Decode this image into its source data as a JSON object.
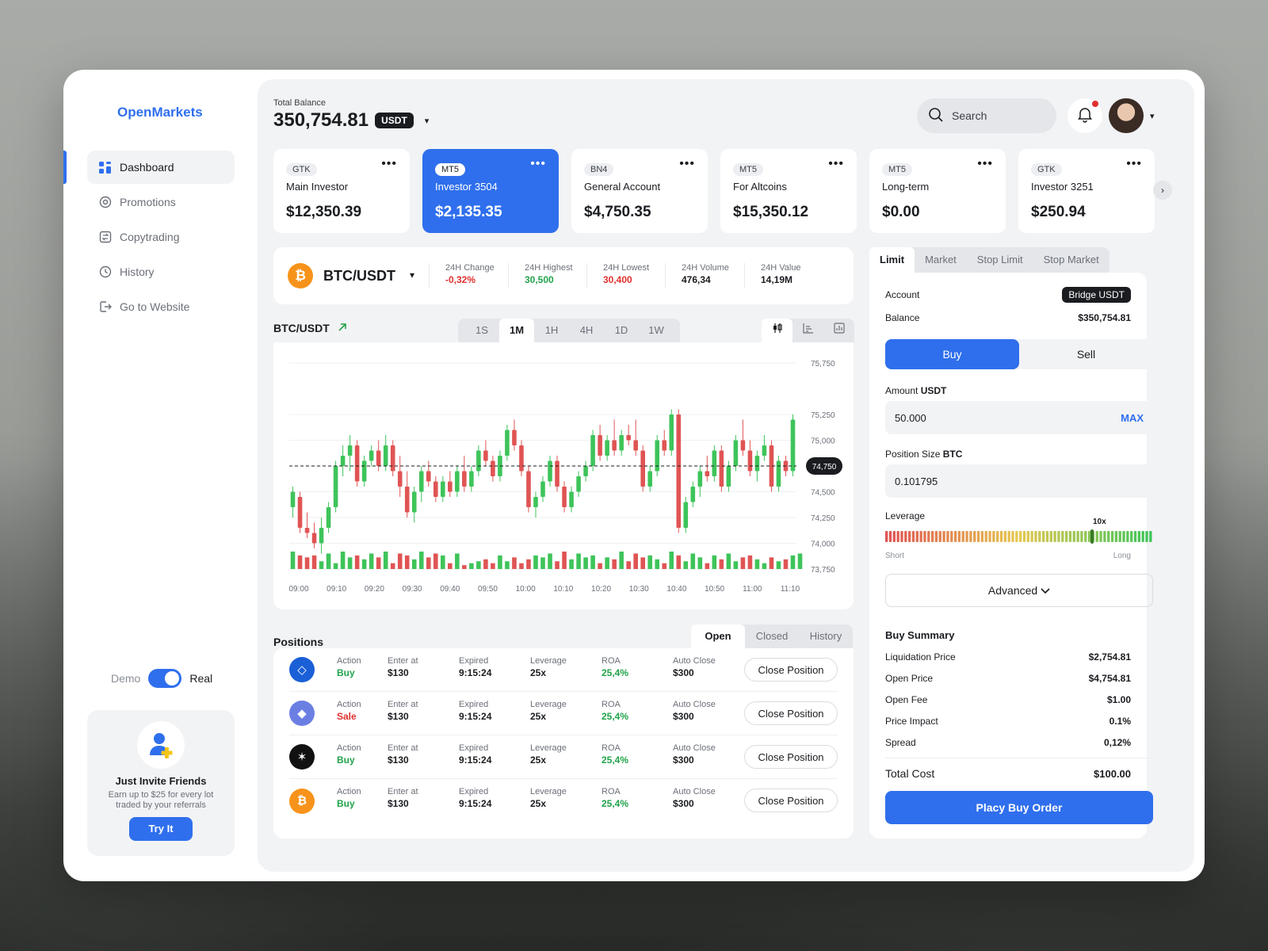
{
  "app": {
    "name": "OpenMarkets"
  },
  "sidebar": {
    "items": [
      {
        "label": "Dashboard",
        "icon": "dashboard-icon",
        "active": true
      },
      {
        "label": "Promotions",
        "icon": "promotions-icon"
      },
      {
        "label": "Copytrading",
        "icon": "copytrading-icon"
      },
      {
        "label": "History",
        "icon": "history-icon"
      },
      {
        "label": "Go to Website",
        "icon": "logout-icon"
      }
    ],
    "mode": {
      "left": "Demo",
      "right": "Real",
      "enabled": true
    },
    "invite": {
      "title": "Just Invite Friends",
      "text": "Earn up to $25 for every lot traded by your referrals",
      "button": "Try It"
    }
  },
  "header": {
    "balance_label": "Total Balance",
    "balance_value": "350,754.81",
    "currency": "USDT",
    "search_placeholder": "Search",
    "notifications_unread": true
  },
  "accounts": [
    {
      "tag": "GTK",
      "name": "Main Investor",
      "balance": "$12,350.39",
      "active": false
    },
    {
      "tag": "MT5",
      "name": "Investor 3504",
      "balance": "$2,135.35",
      "active": true
    },
    {
      "tag": "BN4",
      "name": "General Account",
      "balance": "$4,750.35",
      "active": false
    },
    {
      "tag": "MT5",
      "name": "For Altcoins",
      "balance": "$15,350.12",
      "active": false
    },
    {
      "tag": "MT5",
      "name": "Long-term",
      "balance": "$0.00",
      "active": false
    },
    {
      "tag": "GTK",
      "name": "Investor 3251",
      "balance": "$250.94",
      "active": false
    }
  ],
  "ticker": {
    "pair": "BTC/USDT",
    "stats": [
      {
        "label": "24H Change",
        "value": "-0,32%",
        "tone": "neg"
      },
      {
        "label": "24H Highest",
        "value": "30,500",
        "tone": "pos"
      },
      {
        "label": "24H Lowest",
        "value": "30,400",
        "tone": "neg"
      },
      {
        "label": "24H Volume",
        "value": "476,34",
        "tone": ""
      },
      {
        "label": "24H Value",
        "value": "14,19M",
        "tone": ""
      }
    ]
  },
  "chart": {
    "title": "BTC/USDT",
    "timeframes": [
      "1S",
      "1M",
      "1H",
      "4H",
      "1D",
      "1W"
    ],
    "active_timeframe": "1M",
    "chart_types": [
      "candles-icon",
      "bar-chart-icon",
      "volume-chart-icon"
    ]
  },
  "chart_data": {
    "type": "candlestick",
    "ylim": [
      73750,
      75750
    ],
    "y_ticks": [
      75750,
      75250,
      75000,
      74750,
      74500,
      74250,
      74000,
      73750
    ],
    "y_tick_labels": [
      "75,750",
      "75,250",
      "75,000",
      "74,750",
      "74,500",
      "74,250",
      "74,000",
      "73,750"
    ],
    "x_labels": [
      "09:00",
      "09:10",
      "09:20",
      "09:30",
      "09:40",
      "09:50",
      "10:00",
      "10:10",
      "10:20",
      "10:30",
      "10:40",
      "10:50",
      "11:00",
      "11:10"
    ],
    "current_price_label": "74,750",
    "current_price": 74750,
    "colors": {
      "up": "#3ec45a",
      "down": "#e05454"
    },
    "candles": [
      [
        74350,
        74550,
        74250,
        74500
      ],
      [
        74450,
        74500,
        74100,
        74150
      ],
      [
        74150,
        74300,
        74050,
        74100
      ],
      [
        74100,
        74200,
        73950,
        74000
      ],
      [
        74000,
        74250,
        73900,
        74150
      ],
      [
        74150,
        74400,
        74100,
        74350
      ],
      [
        74350,
        74800,
        74300,
        74750
      ],
      [
        74750,
        74950,
        74650,
        74850
      ],
      [
        74850,
        75050,
        74700,
        74950
      ],
      [
        74950,
        75000,
        74550,
        74600
      ],
      [
        74600,
        74850,
        74550,
        74800
      ],
      [
        74800,
        74950,
        74750,
        74900
      ],
      [
        74900,
        75000,
        74700,
        74750
      ],
      [
        74750,
        75050,
        74700,
        74950
      ],
      [
        74950,
        75000,
        74650,
        74700
      ],
      [
        74700,
        74850,
        74450,
        74550
      ],
      [
        74550,
        74700,
        74250,
        74300
      ],
      [
        74300,
        74550,
        74200,
        74500
      ],
      [
        74500,
        74750,
        74400,
        74700
      ],
      [
        74700,
        74800,
        74550,
        74600
      ],
      [
        74600,
        74650,
        74400,
        74450
      ],
      [
        74450,
        74650,
        74400,
        74600
      ],
      [
        74600,
        74700,
        74450,
        74500
      ],
      [
        74500,
        74750,
        74450,
        74700
      ],
      [
        74700,
        74850,
        74500,
        74550
      ],
      [
        74550,
        74750,
        74500,
        74700
      ],
      [
        74700,
        74950,
        74650,
        74900
      ],
      [
        74900,
        75000,
        74750,
        74800
      ],
      [
        74800,
        74850,
        74600,
        74650
      ],
      [
        74650,
        74900,
        74600,
        74850
      ],
      [
        74850,
        75150,
        74800,
        75100
      ],
      [
        75100,
        75200,
        74900,
        74950
      ],
      [
        74950,
        75000,
        74650,
        74700
      ],
      [
        74700,
        74750,
        74300,
        74350
      ],
      [
        74350,
        74500,
        74250,
        74450
      ],
      [
        74450,
        74650,
        74400,
        74600
      ],
      [
        74600,
        74850,
        74550,
        74800
      ],
      [
        74800,
        74850,
        74500,
        74550
      ],
      [
        74550,
        74600,
        74300,
        74350
      ],
      [
        74350,
        74550,
        74300,
        74500
      ],
      [
        74500,
        74700,
        74450,
        74650
      ],
      [
        74650,
        74800,
        74600,
        74750
      ],
      [
        74750,
        75100,
        74700,
        75050
      ],
      [
        75050,
        75150,
        74800,
        74850
      ],
      [
        74850,
        75050,
        74800,
        75000
      ],
      [
        75000,
        75200,
        74850,
        74900
      ],
      [
        74900,
        75100,
        74850,
        75050
      ],
      [
        75050,
        75150,
        74950,
        75000
      ],
      [
        75000,
        75200,
        74850,
        74900
      ],
      [
        74900,
        74950,
        74500,
        74550
      ],
      [
        74550,
        74750,
        74500,
        74700
      ],
      [
        74700,
        75050,
        74650,
        75000
      ],
      [
        75000,
        75100,
        74850,
        74900
      ],
      [
        74900,
        75300,
        74850,
        75250
      ],
      [
        75250,
        75300,
        74100,
        74150
      ],
      [
        74150,
        74450,
        74100,
        74400
      ],
      [
        74400,
        74600,
        74350,
        74550
      ],
      [
        74550,
        74750,
        74450,
        74700
      ],
      [
        74700,
        74850,
        74600,
        74650
      ],
      [
        74650,
        74950,
        74600,
        74900
      ],
      [
        74900,
        74950,
        74500,
        74550
      ],
      [
        74550,
        74800,
        74500,
        74750
      ],
      [
        74750,
        75050,
        74700,
        75000
      ],
      [
        75000,
        75200,
        74850,
        74900
      ],
      [
        74900,
        75000,
        74650,
        74700
      ],
      [
        74700,
        74900,
        74600,
        74850
      ],
      [
        74850,
        75050,
        74800,
        74950
      ],
      [
        74950,
        75000,
        74500,
        74550
      ],
      [
        74550,
        74850,
        74500,
        74800
      ],
      [
        74800,
        74850,
        74650,
        74700
      ],
      [
        74700,
        75250,
        74650,
        75200
      ]
    ],
    "volume": [
      9,
      7,
      6,
      7,
      4,
      8,
      3,
      9,
      6,
      7,
      5,
      8,
      6,
      9,
      3,
      8,
      7,
      5,
      9,
      6,
      8,
      7,
      3,
      8,
      2,
      3,
      4,
      5,
      3,
      7,
      4,
      6,
      3,
      5,
      7,
      6,
      8,
      4,
      9,
      5,
      8,
      6,
      7,
      3,
      6,
      5,
      9,
      4,
      8,
      6,
      7,
      5,
      3,
      9,
      7,
      4,
      8,
      6,
      3,
      7,
      5,
      8,
      4,
      6,
      7,
      5,
      3,
      6,
      4,
      5,
      7,
      8
    ]
  },
  "positions": {
    "title": "Positions",
    "tabs": [
      "Open",
      "Closed",
      "History"
    ],
    "active_tab": "Open",
    "headers": [
      "Action",
      "Enter at",
      "Expired",
      "Leverage",
      "ROA",
      "Auto Close"
    ],
    "button_label": "Close Position",
    "rows": [
      {
        "coin_icon": "eos-icon",
        "coin_color": "#1a5fd6",
        "action": "Buy",
        "action_tone": "buy",
        "enter": "$130",
        "expired": "9:15:24",
        "leverage": "25x",
        "roa": "25,4%",
        "auto_close": "$300"
      },
      {
        "coin_icon": "ethereum-icon",
        "coin_color": "#6b7fe3",
        "action": "Sale",
        "action_tone": "sale",
        "enter": "$130",
        "expired": "9:15:24",
        "leverage": "25x",
        "roa": "25,4%",
        "auto_close": "$300"
      },
      {
        "coin_icon": "stellar-icon",
        "coin_color": "#111111",
        "action": "Buy",
        "action_tone": "buy",
        "enter": "$130",
        "expired": "9:15:24",
        "leverage": "25x",
        "roa": "25,4%",
        "auto_close": "$300"
      },
      {
        "coin_icon": "bitcoin-icon",
        "coin_color": "#f7931a",
        "action": "Buy",
        "action_tone": "buy",
        "enter": "$130",
        "expired": "9:15:24",
        "leverage": "25x",
        "roa": "25,4%",
        "auto_close": "$300"
      }
    ]
  },
  "order": {
    "tabs": [
      "Limit",
      "Market",
      "Stop Limit",
      "Stop Market"
    ],
    "active_tab": "Limit",
    "account_label": "Account",
    "account_value": "Bridge USDT",
    "balance_label": "Balance",
    "balance_value": "$350,754.81",
    "buy_label": "Buy",
    "sell_label": "Sell",
    "side": "Buy",
    "amount_label": "Amount",
    "amount_unit": "USDT",
    "amount_value": "50.000",
    "max_label": "MAX",
    "position_label": "Position Size",
    "position_unit": "BTC",
    "position_value": "0.101795",
    "leverage_label": "Leverage",
    "leverage_value": "10x",
    "leverage_fraction": 0.82,
    "short_label": "Short",
    "long_label": "Long",
    "advanced_label": "Advanced",
    "summary_title": "Buy Summary",
    "summary": [
      {
        "label": "Liquidation Price",
        "value": "$2,754.81"
      },
      {
        "label": "Open Price",
        "value": "$4,754.81"
      },
      {
        "label": "Open Fee",
        "value": "$1.00"
      },
      {
        "label": "Price Impact",
        "value": "0.1%"
      },
      {
        "label": "Spread",
        "value": "0,12%"
      }
    ],
    "total_label": "Total Cost",
    "total_value": "$100.00",
    "submit_label": "Placy Buy Order"
  }
}
